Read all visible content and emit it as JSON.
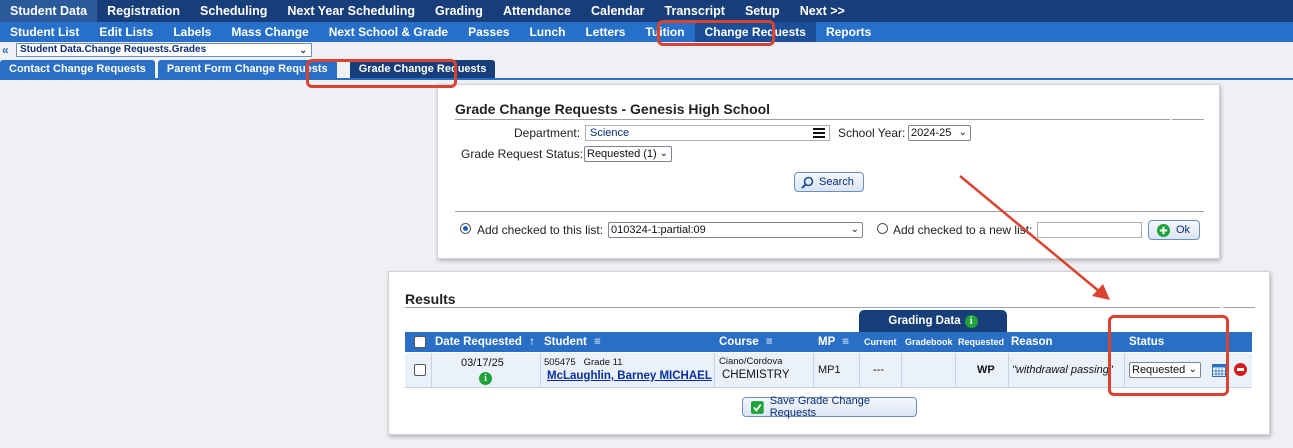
{
  "nav_primary": [
    "Student Data",
    "Registration",
    "Scheduling",
    "Next Year Scheduling",
    "Grading",
    "Attendance",
    "Calendar",
    "Transcript",
    "Setup",
    "Next >>"
  ],
  "nav_secondary": [
    "Student List",
    "Edit Lists",
    "Labels",
    "Mass Change",
    "Next School & Grade",
    "Passes",
    "Lunch",
    "Letters",
    "Tuition",
    "Change Requests",
    "Reports"
  ],
  "breadcrumb": {
    "collapse_icon": "«",
    "value": "Student Data.Change Requests.Grades"
  },
  "subtabs": [
    "Contact Change Requests",
    "Parent Form Change Requests",
    "Grade Change Requests"
  ],
  "search_panel": {
    "title": "Grade Change Requests - Genesis High School",
    "department_label": "Department:",
    "department_value": "Science",
    "school_year_label": "School Year:",
    "school_year_value": "2024-25",
    "status_label": "Grade Request Status:",
    "status_value": "Requested (1)",
    "search_button": "Search",
    "add_checked_label": "Add checked to this list:",
    "list_value": "010324-1:partial:09",
    "add_new_label": "Add checked to a new list:",
    "new_list_value": "",
    "ok_button": "Ok"
  },
  "results": {
    "title": "Results",
    "grading_data_tab": "Grading Data",
    "columns": {
      "date": "Date Requested",
      "sort_arrow": "↑",
      "student": "Student",
      "course": "Course",
      "mp": "MP",
      "current": "Current",
      "gradebook": "Gradebook",
      "requested": "Requested",
      "reason": "Reason",
      "status": "Status"
    },
    "rows": [
      {
        "date": "03/17/25",
        "student_id": "505475",
        "grade": "Grade 11",
        "student_name": "McLaughlin, Barney MICHAEL",
        "teacher": "Ciano/Cordova",
        "course": "CHEMISTRY",
        "mp": "MP1",
        "current": "---",
        "gradebook": "",
        "requested": "WP",
        "reason": "\"withdrawal passing\"",
        "status": "Requested"
      }
    ],
    "save_button": "Save Grade Change Requests"
  },
  "colors": {
    "nav_dark": "#173e78",
    "nav_blue": "#2670c9",
    "highlight": "#d9432f",
    "info_green": "#1ea33a"
  }
}
